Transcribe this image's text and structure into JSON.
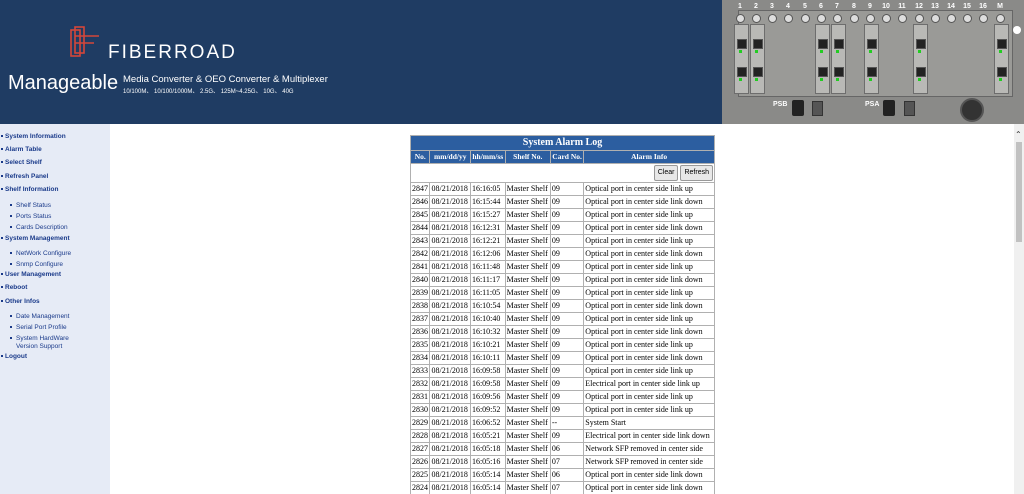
{
  "header": {
    "brand": "FIBERROAD",
    "product_line": "Manageable",
    "tagline": "Media Converter & OEO Converter & Multiplexer",
    "speeds": "10/100M、 10/100/1000M、 2.5G、 125M~4.25G、 10G、 40G",
    "slot_numbers": [
      "1",
      "2",
      "3",
      "4",
      "5",
      "6",
      "7",
      "8",
      "9",
      "10",
      "11",
      "12",
      "13",
      "14",
      "15",
      "16",
      "M"
    ],
    "psb_label": "PSB",
    "psa_label": "PSA"
  },
  "sidebar": {
    "items": [
      {
        "label": "System Information"
      },
      {
        "label": "Alarm Table"
      },
      {
        "label": "Select Shelf"
      },
      {
        "label": "Refresh Panel"
      },
      {
        "label": "Shelf Information"
      },
      {
        "label": "Shelf Status"
      },
      {
        "label": "Ports Status"
      },
      {
        "label": "Cards Description"
      },
      {
        "label": "System Management"
      },
      {
        "label": "NetWork Configure"
      },
      {
        "label": "Snmp Configure"
      },
      {
        "label": "User Management"
      },
      {
        "label": "Reboot"
      },
      {
        "label": "Other Infos"
      },
      {
        "label": "Date Management"
      },
      {
        "label": "Serial Port Profile"
      },
      {
        "label": "System HardWare"
      },
      {
        "label": "Version Support"
      },
      {
        "label": "Logout"
      }
    ]
  },
  "log": {
    "title": "System Alarm Log",
    "columns": [
      "No.",
      "mm/dd/yy",
      "hh/mm/ss",
      "Shelf No.",
      "Card No.",
      "Alarm Info"
    ],
    "clear_label": "Clear",
    "refresh_label": "Refresh",
    "rows": [
      [
        "2847",
        "08/21/2018",
        "16:16:05",
        "Master Shelf",
        "09",
        "Optical port in center side link up"
      ],
      [
        "2846",
        "08/21/2018",
        "16:15:44",
        "Master Shelf",
        "09",
        "Optical port in center side link down"
      ],
      [
        "2845",
        "08/21/2018",
        "16:15:27",
        "Master Shelf",
        "09",
        "Optical port in center side link up"
      ],
      [
        "2844",
        "08/21/2018",
        "16:12:31",
        "Master Shelf",
        "09",
        "Optical port in center side link down"
      ],
      [
        "2843",
        "08/21/2018",
        "16:12:21",
        "Master Shelf",
        "09",
        "Optical port in center side link up"
      ],
      [
        "2842",
        "08/21/2018",
        "16:12:06",
        "Master Shelf",
        "09",
        "Optical port in center side link down"
      ],
      [
        "2841",
        "08/21/2018",
        "16:11:48",
        "Master Shelf",
        "09",
        "Optical port in center side link up"
      ],
      [
        "2840",
        "08/21/2018",
        "16:11:17",
        "Master Shelf",
        "09",
        "Optical port in center side link down"
      ],
      [
        "2839",
        "08/21/2018",
        "16:11:05",
        "Master Shelf",
        "09",
        "Optical port in center side link up"
      ],
      [
        "2838",
        "08/21/2018",
        "16:10:54",
        "Master Shelf",
        "09",
        "Optical port in center side link down"
      ],
      [
        "2837",
        "08/21/2018",
        "16:10:40",
        "Master Shelf",
        "09",
        "Optical port in center side link up"
      ],
      [
        "2836",
        "08/21/2018",
        "16:10:32",
        "Master Shelf",
        "09",
        "Optical port in center side link down"
      ],
      [
        "2835",
        "08/21/2018",
        "16:10:21",
        "Master Shelf",
        "09",
        "Optical port in center side link up"
      ],
      [
        "2834",
        "08/21/2018",
        "16:10:11",
        "Master Shelf",
        "09",
        "Optical port in center side link down"
      ],
      [
        "2833",
        "08/21/2018",
        "16:09:58",
        "Master Shelf",
        "09",
        "Optical port in center side link up"
      ],
      [
        "2832",
        "08/21/2018",
        "16:09:58",
        "Master Shelf",
        "09",
        "Electrical port in center side link up"
      ],
      [
        "2831",
        "08/21/2018",
        "16:09:56",
        "Master Shelf",
        "09",
        "Optical port in center side link up"
      ],
      [
        "2830",
        "08/21/2018",
        "16:09:52",
        "Master Shelf",
        "09",
        "Optical port in center side link up"
      ],
      [
        "2829",
        "08/21/2018",
        "16:06:52",
        "Master Shelf",
        "--",
        "System Start"
      ],
      [
        "2828",
        "08/21/2018",
        "16:05:21",
        "Master Shelf",
        "09",
        "Electrical port in center side link down"
      ],
      [
        "2827",
        "08/21/2018",
        "16:05:18",
        "Master Shelf",
        "06",
        "Network SFP removed in center side"
      ],
      [
        "2826",
        "08/21/2018",
        "16:05:16",
        "Master Shelf",
        "07",
        "Network SFP removed in center side"
      ],
      [
        "2825",
        "08/21/2018",
        "16:05:14",
        "Master Shelf",
        "06",
        "Optical port in center side link down"
      ],
      [
        "2824",
        "08/21/2018",
        "16:05:14",
        "Master Shelf",
        "07",
        "Optical port in center side link down"
      ]
    ]
  },
  "colors": {
    "header_bg": "#1f3c63",
    "table_header": "#2c5ea0",
    "sidebar_bg": "#e6ebf6",
    "logo_red": "#d4473a"
  }
}
